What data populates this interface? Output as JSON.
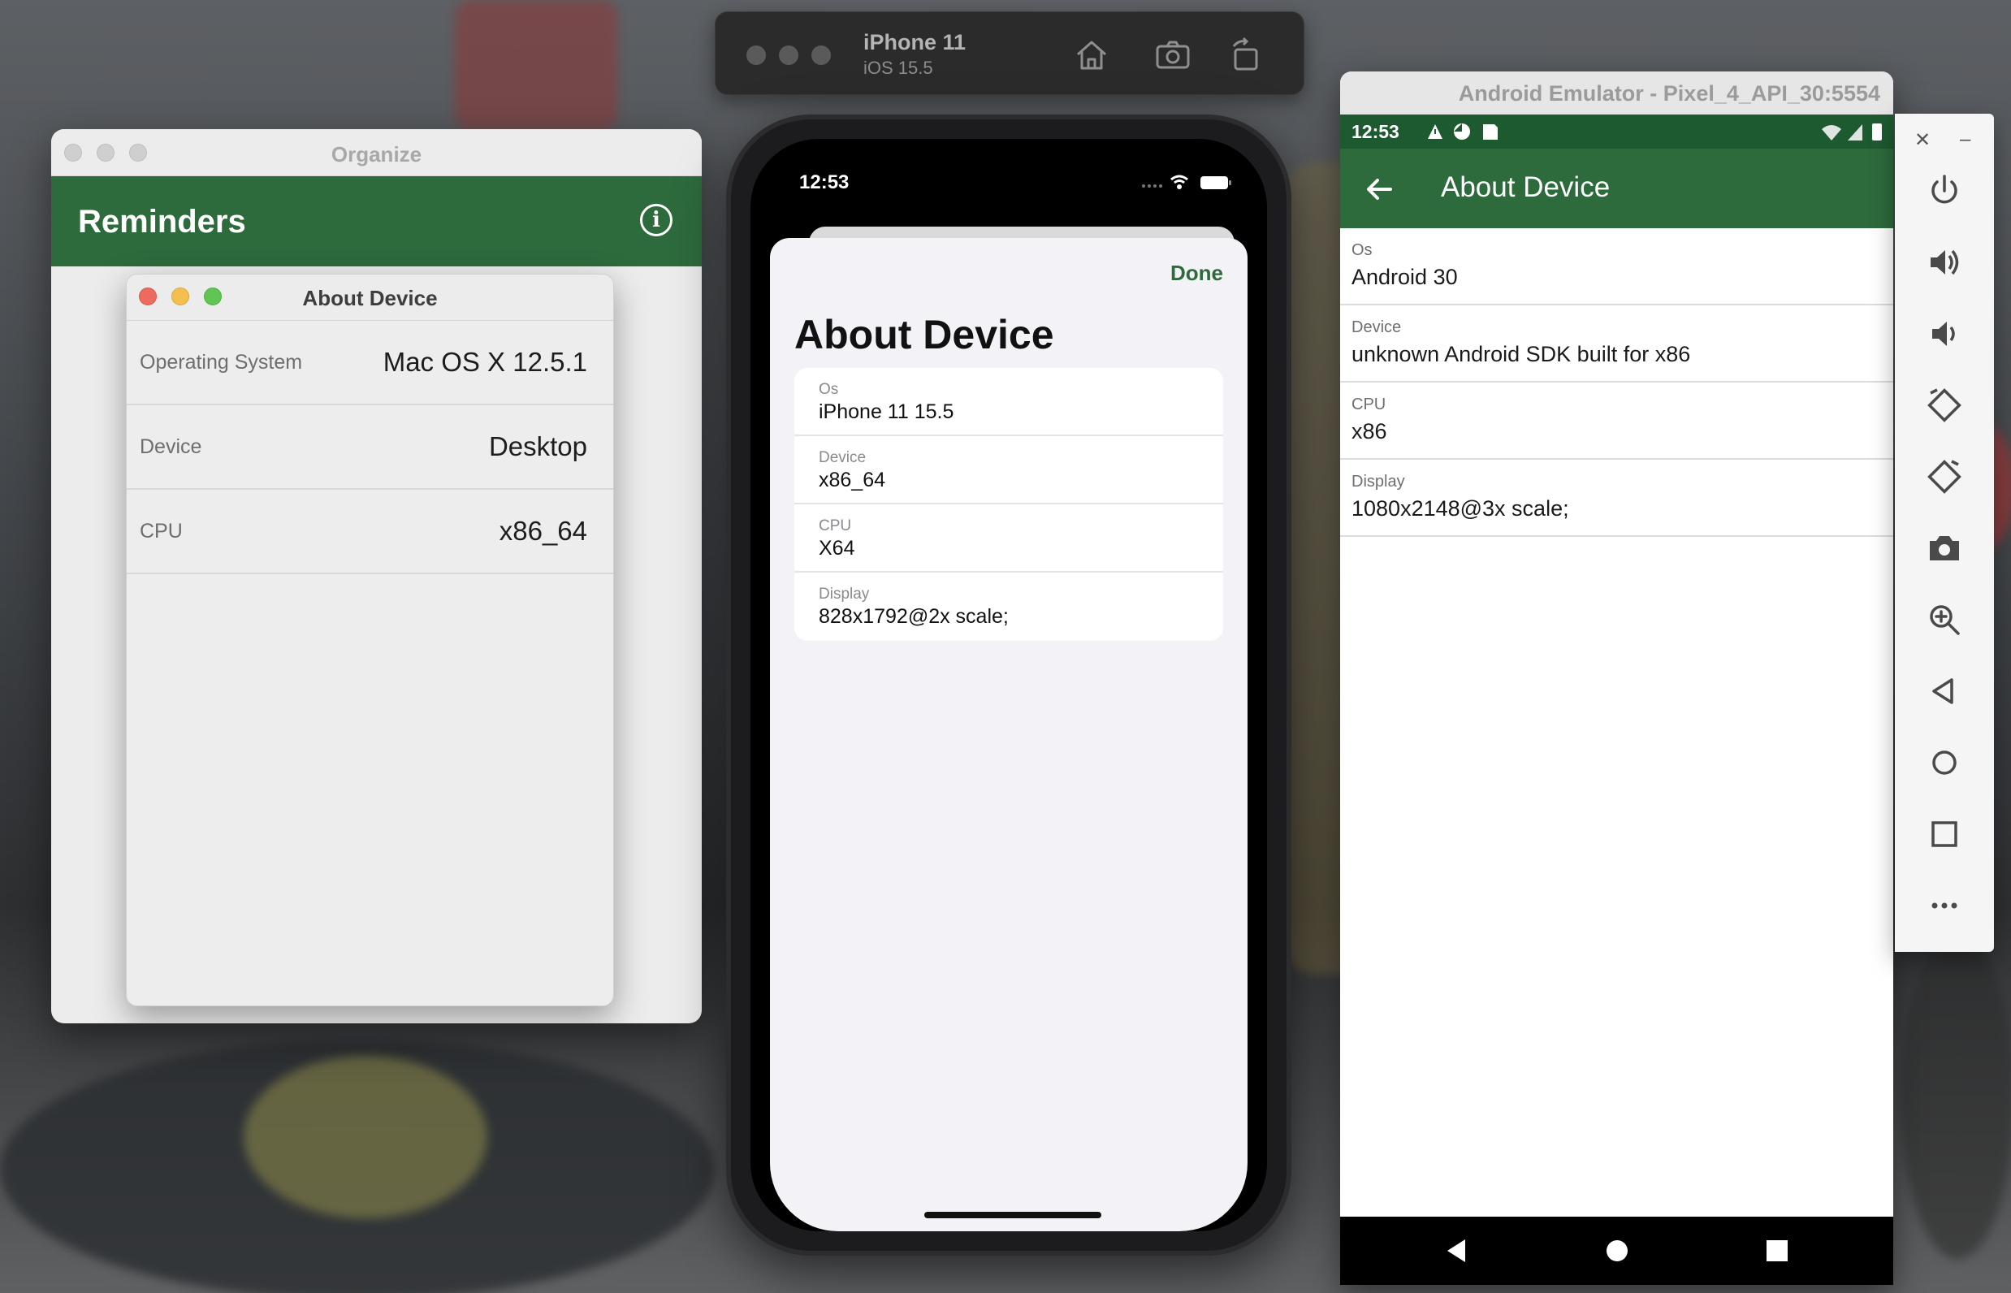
{
  "mac_window": {
    "title": "Organize",
    "header_title": "Reminders",
    "about": {
      "title": "About Device",
      "rows": [
        {
          "label": "Operating System",
          "value": "Mac OS X 12.5.1"
        },
        {
          "label": "Device",
          "value": "Desktop"
        },
        {
          "label": "CPU",
          "value": "x86_64"
        }
      ]
    }
  },
  "ios_simulator": {
    "device_name": "iPhone 11",
    "os_version": "iOS 15.5",
    "toolbar_icons": [
      "home-icon",
      "screenshot-icon",
      "rotate-icon"
    ],
    "status_time": "12:53",
    "done_label": "Done",
    "heading": "About Device",
    "rows": [
      {
        "label": "Os",
        "value": "iPhone 11 15.5"
      },
      {
        "label": "Device",
        "value": "x86_64"
      },
      {
        "label": "CPU",
        "value": "X64"
      },
      {
        "label": "Display",
        "value": "828x1792@2x scale;"
      }
    ]
  },
  "android_emulator": {
    "window_title": "Android Emulator - Pixel_4_API_30:5554",
    "status_time": "12:53",
    "appbar_title": "About Device",
    "rows": [
      {
        "label": "Os",
        "value": "Android 30"
      },
      {
        "label": "Device",
        "value": "unknown Android SDK built for x86"
      },
      {
        "label": "CPU",
        "value": "x86"
      },
      {
        "label": "Display",
        "value": "1080x2148@3x scale;"
      }
    ],
    "sidebar_icons": [
      "power-icon",
      "volume-up-icon",
      "volume-down-icon",
      "rotate-left-icon",
      "rotate-right-icon",
      "camera-icon",
      "zoom-icon",
      "back-icon",
      "home-icon",
      "overview-icon",
      "more-icon"
    ]
  },
  "colors": {
    "accent_green": "#2d6a3c",
    "android_status_green": "#1e5a30"
  }
}
